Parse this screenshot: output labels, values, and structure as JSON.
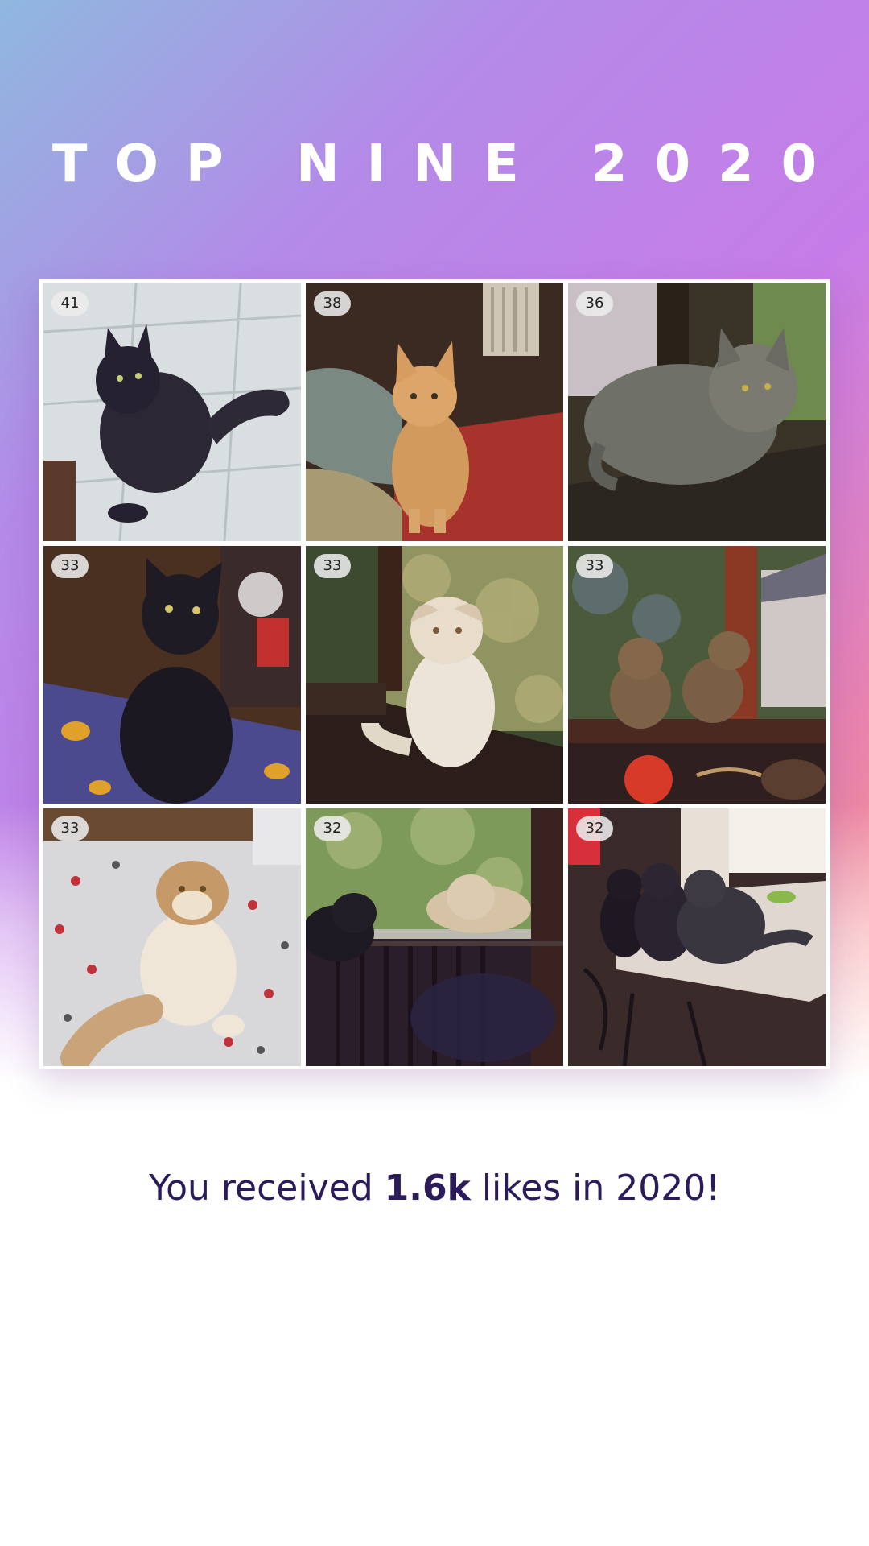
{
  "title": "TOP NINE 2020",
  "posts": [
    {
      "likes": "41",
      "subject": "black-fluffy-cat-on-tiles"
    },
    {
      "likes": "38",
      "subject": "ginger-kitten-on-blanket"
    },
    {
      "likes": "36",
      "subject": "grey-longhair-cat-on-porch"
    },
    {
      "likes": "33",
      "subject": "black-cat-sitting-on-bed"
    },
    {
      "likes": "33",
      "subject": "cream-cat-on-railing"
    },
    {
      "likes": "33",
      "subject": "two-tabby-cats-on-porch"
    },
    {
      "likes": "33",
      "subject": "cream-fold-cat-on-bedspread"
    },
    {
      "likes": "32",
      "subject": "black-and-cream-cats-on-window"
    },
    {
      "likes": "32",
      "subject": "three-cats-on-table"
    }
  ],
  "summary": {
    "prefix": "You received ",
    "likes_total": "1.6k",
    "suffix": " likes in 2020!"
  },
  "colors": {
    "title": "#ffffff",
    "summary_text": "#2b1b5a",
    "gradient": [
      "#8fb8df",
      "#b48ae8",
      "#c67ce8",
      "#e883b0",
      "#ff9a78"
    ]
  }
}
